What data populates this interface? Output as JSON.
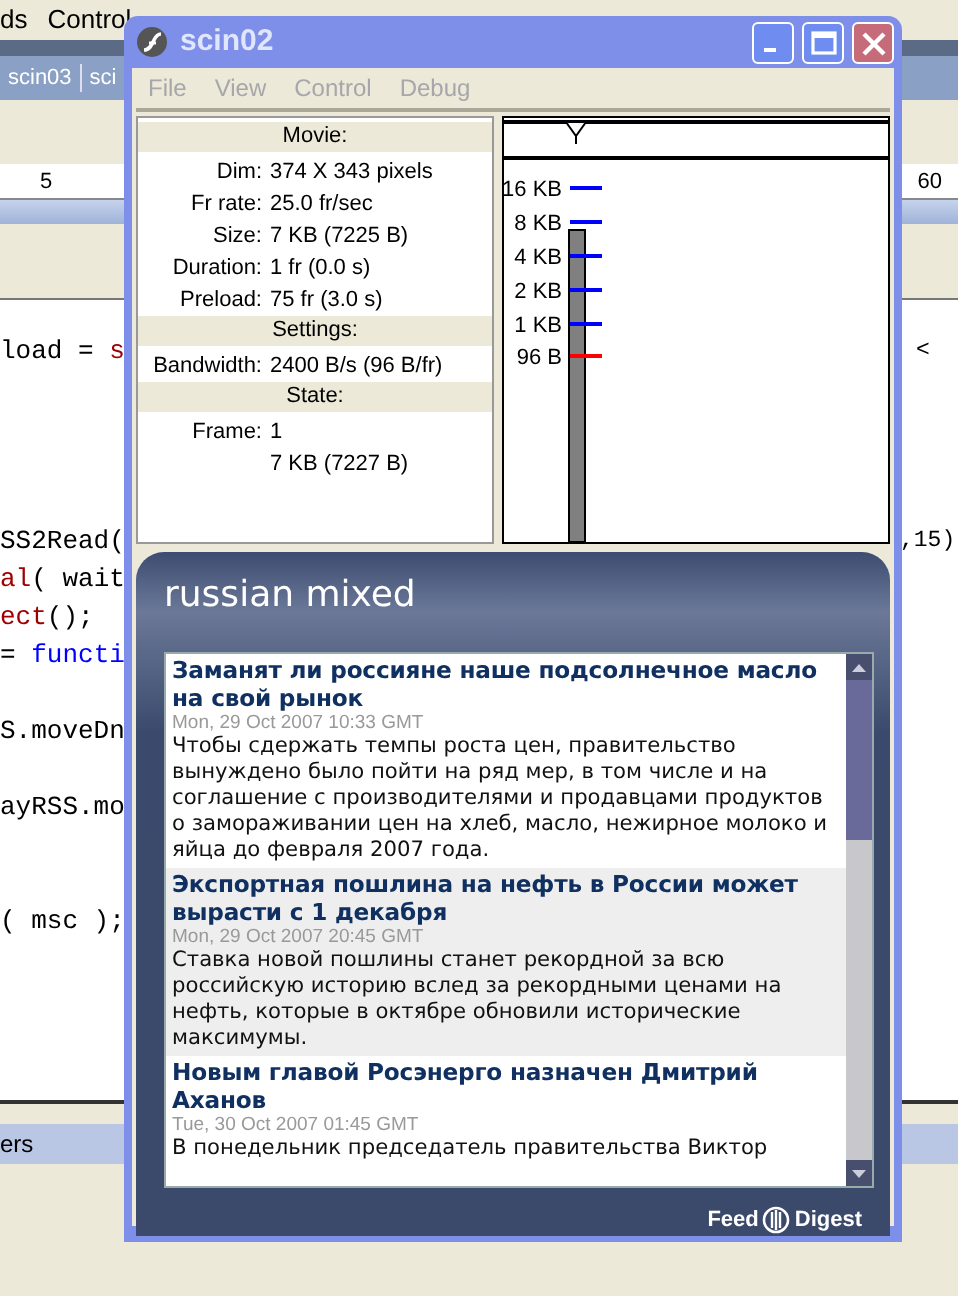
{
  "ide": {
    "menu": [
      "ds",
      "Control"
    ],
    "tabs": [
      "scin03",
      "sci"
    ],
    "ruler": [
      "5",
      "60"
    ],
    "code_left": [
      {
        "segments": [
          {
            "text": "load = ",
            "kind": "plain"
          },
          {
            "text": "s",
            "kind": "keyword"
          }
        ]
      },
      {
        "segments": [
          {
            "text": "SS2Read(",
            "kind": "plain"
          }
        ]
      },
      {
        "segments": [
          {
            "text": "al",
            "kind": "keyword"
          },
          {
            "text": "( wait",
            "kind": "plain"
          }
        ]
      },
      {
        "segments": [
          {
            "text": "ect",
            "kind": "keyword"
          },
          {
            "text": "();",
            "kind": "plain"
          }
        ]
      },
      {
        "segments": [
          {
            "text": "= ",
            "kind": "plain"
          },
          {
            "text": "functi",
            "kind": "builtin"
          }
        ]
      },
      {
        "segments": [
          {
            "text": "S.moveDn",
            "kind": "plain"
          }
        ]
      },
      {
        "segments": [
          {
            "text": "ayRSS.mo",
            "kind": "plain"
          }
        ]
      },
      {
        "segments": [
          {
            "text": "( msc );",
            "kind": "plain"
          }
        ]
      }
    ],
    "code_right": [
      "<",
      ",15)"
    ],
    "panel_tab": "ers"
  },
  "player": {
    "title": "scin02",
    "menu": [
      {
        "label": "File",
        "disabled": true
      },
      {
        "label": "View",
        "disabled": true
      },
      {
        "label": "Control",
        "disabled": true
      },
      {
        "label": "Debug",
        "disabled": true
      }
    ],
    "stats": [
      {
        "kind": "header",
        "text": "Movie:"
      },
      {
        "kind": "row",
        "label": "Dim:",
        "value": "374 X 343 pixels"
      },
      {
        "kind": "row",
        "label": "Fr rate:",
        "value": "25.0 fr/sec"
      },
      {
        "kind": "row",
        "label": "Size:",
        "value": "7 KB (7225 B)"
      },
      {
        "kind": "row",
        "label": "Duration:",
        "value": "1 fr (0.0 s)"
      },
      {
        "kind": "row",
        "label": "Preload:",
        "value": "75 fr (3.0 s)"
      },
      {
        "kind": "header",
        "text": "Settings:"
      },
      {
        "kind": "row",
        "label": "Bandwidth:",
        "value": "2400 B/s (96 B/fr)"
      },
      {
        "kind": "header",
        "text": "State:"
      },
      {
        "kind": "row",
        "label": "Frame:",
        "value": "1"
      },
      {
        "kind": "value",
        "value": "7 KB (7227 B)"
      }
    ],
    "bandwidth_ticks": [
      {
        "label": "16 KB",
        "color": "#0000ff"
      },
      {
        "label": "8 KB",
        "color": "#0000ff"
      },
      {
        "label": "4 KB",
        "color": "#0000ff"
      },
      {
        "label": "2 KB",
        "color": "#0000ff"
      },
      {
        "label": "1 KB",
        "color": "#0000ff"
      },
      {
        "label": "96 B",
        "color": "#ff0000"
      }
    ],
    "feed": {
      "title": "russian mixed",
      "items": [
        {
          "title": "Заманят ли россияне наше подсолнечное масло на свой рынок",
          "date": "Mon, 29 Oct 2007 10:33 GMT",
          "text": "Чтобы сдержать темпы роста цен, правительство вынуждено было пойти на ряд мер, в том числе и на соглашение с производителями и продавцами продуктов о замораживании цен на хлеб, масло, нежирное молоко и яйца до февраля 2007 года.",
          "highlighted": false
        },
        {
          "title": "Экспортная пошлина на нефть в России может вырасти с 1 декабря",
          "date": "Mon, 29 Oct 2007 20:45 GMT",
          "text": "Ставка новой пошлины станет рекордной за всю российскую историю вслед за рекордными ценами на нефть, которые в октябре обновили исторические максимумы.",
          "highlighted": true
        },
        {
          "title": "Новым главой Росэнерго назначен Дмитрий Аханов",
          "date": "Tue, 30 Oct 2007 01:45 GMT",
          "text": "В понедельник председатель правительства  Виктор",
          "highlighted": false
        }
      ],
      "footer_left": "Feed",
      "footer_right": "Digest"
    }
  }
}
